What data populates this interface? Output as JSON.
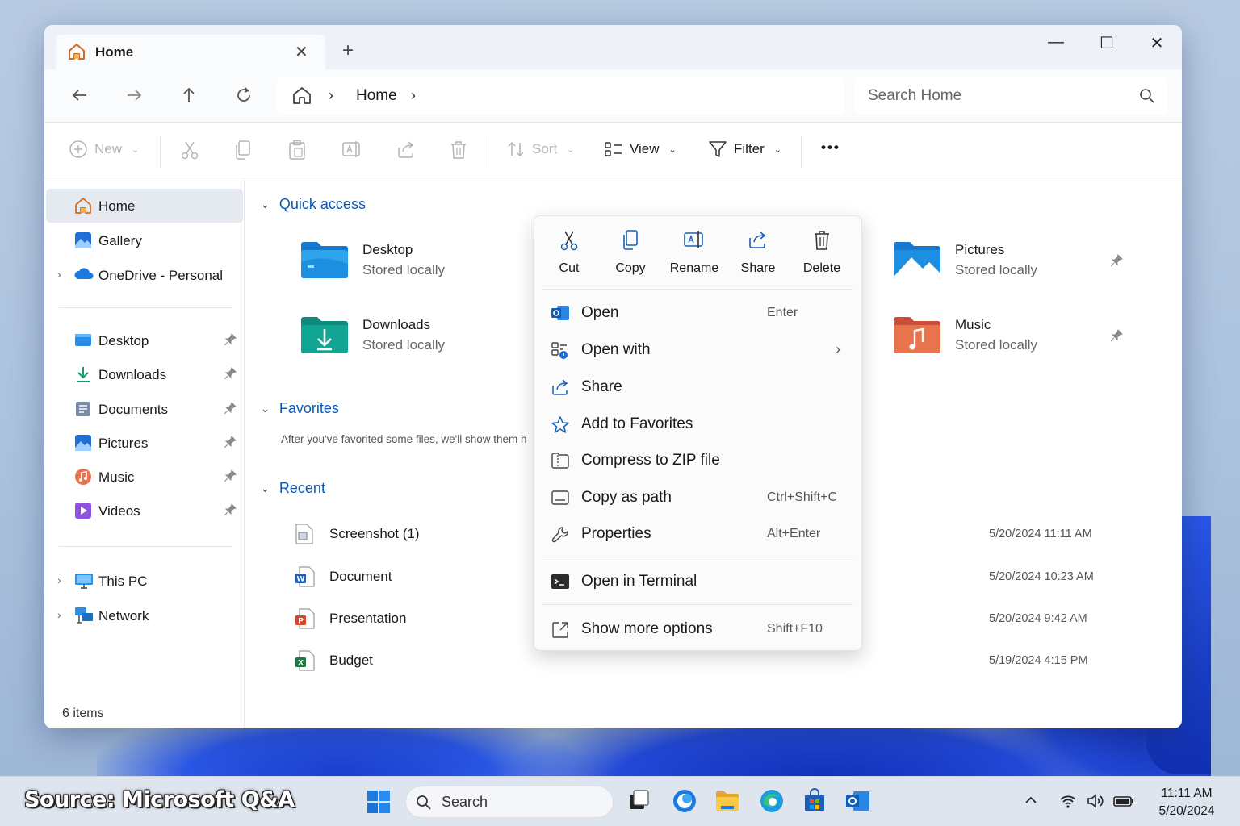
{
  "window": {
    "tab_title": "Home",
    "close_tab": "✕",
    "new_tab": "+",
    "controls": {
      "minimize": "—",
      "maximize": "☐",
      "close": "✕"
    }
  },
  "nav": {
    "breadcrumb": [
      "Home"
    ],
    "search_placeholder": "Search Home"
  },
  "toolbar": {
    "new_label": "New",
    "sort_label": "Sort",
    "view_label": "View",
    "filter_label": "Filter",
    "more_label": "•••"
  },
  "sidebar": {
    "items": [
      {
        "label": "Home",
        "icon": "home-icon",
        "active": true
      },
      {
        "label": "Gallery",
        "icon": "gallery-icon"
      },
      {
        "label": "OneDrive - Personal",
        "icon": "onedrive-icon"
      },
      {
        "label": "Desktop",
        "icon": "desktop-folder-icon"
      },
      {
        "label": "Downloads",
        "icon": "downloads-icon"
      },
      {
        "label": "Documents",
        "icon": "documents-icon"
      },
      {
        "label": "Pictures",
        "icon": "pictures-icon"
      },
      {
        "label": "Music",
        "icon": "music-icon"
      },
      {
        "label": "Videos",
        "icon": "videos-icon"
      },
      {
        "label": "This PC",
        "icon": "this-pc-icon"
      },
      {
        "label": "Network",
        "icon": "network-icon"
      }
    ],
    "status": "6 items"
  },
  "main": {
    "quick_access_title": "Quick access",
    "quick_access": [
      {
        "name": "Desktop",
        "sub": "Stored locally"
      },
      {
        "name": "Downloads",
        "sub": "Stored locally"
      },
      {
        "name": "Pictures",
        "sub": "Stored locally"
      },
      {
        "name": "Music",
        "sub": "Stored locally"
      }
    ],
    "favorites_title": "Favorites",
    "favorites_empty": "After you've favorited some files, we'll show them h",
    "recent_title": "Recent",
    "recent": [
      {
        "name": "Screenshot (1)",
        "date": "5/20/2024 11:11 AM"
      },
      {
        "name": "Document",
        "date": "5/20/2024 10:23 AM"
      },
      {
        "name": "Presentation",
        "date": "5/20/2024 9:42 AM"
      },
      {
        "name": "Budget",
        "date": "5/19/2024 4:15 PM"
      }
    ]
  },
  "context_menu": {
    "actions": [
      "Cut",
      "Copy",
      "Rename",
      "Share",
      "Delete"
    ],
    "items": [
      {
        "label": "Open",
        "shortcut": "Enter"
      },
      {
        "label": "Open with",
        "shortcut": ""
      },
      {
        "label": "Share",
        "shortcut": ""
      },
      {
        "label": "Add to Favorites",
        "shortcut": ""
      },
      {
        "label": "Compress to ZIP file",
        "shortcut": ""
      },
      {
        "label": "Copy as path",
        "shortcut": "Ctrl+Shift+C"
      },
      {
        "label": "Properties",
        "shortcut": "Alt+Enter"
      },
      {
        "label": "Open in Terminal",
        "shortcut": ""
      },
      {
        "label": "Show more options",
        "shortcut": "Shift+F10"
      }
    ]
  },
  "taskbar": {
    "search_label": "Search",
    "time": "11:11 AM",
    "date": "5/20/2024"
  },
  "watermark": "Source: Microsoft Q&A",
  "colors": {
    "accent": "#0a5bb8",
    "folder_blue": "#1e8fe0",
    "folder_teal": "#12a594",
    "music_orange": "#e8744e"
  }
}
